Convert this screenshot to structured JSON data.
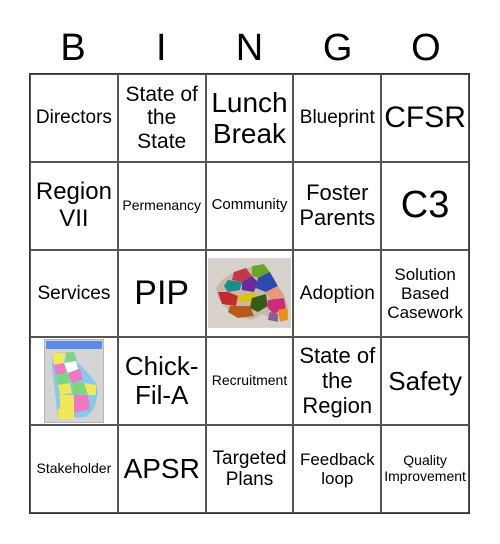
{
  "header": [
    "B",
    "I",
    "N",
    "G",
    "O"
  ],
  "cells": [
    {
      "text": "Directors",
      "size": "s19"
    },
    {
      "text": "State of the State",
      "size": "s21"
    },
    {
      "text": "Lunch Break",
      "size": "s28"
    },
    {
      "text": "Blueprint",
      "size": "s19"
    },
    {
      "text": "CFSR",
      "size": "s30"
    },
    {
      "text": "Region VII",
      "size": "s24"
    },
    {
      "text": "Permenancy",
      "size": "s14"
    },
    {
      "text": "Community",
      "size": "s15"
    },
    {
      "text": "Foster Parents",
      "size": "s22"
    },
    {
      "text": "C3",
      "size": "s38"
    },
    {
      "text": "Services",
      "size": "s19"
    },
    {
      "text": "PIP",
      "size": "s34"
    },
    {
      "image": "region-map-photo"
    },
    {
      "text": "Adoption",
      "size": "s19"
    },
    {
      "text": "Solution Based Casework",
      "size": "s17"
    },
    {
      "image": "georgia-regions-map"
    },
    {
      "text": "Chick-Fil-A",
      "size": "s26"
    },
    {
      "text": "Recruitment",
      "size": "s14"
    },
    {
      "text": "State of the Region",
      "size": "s22"
    },
    {
      "text": "Safety",
      "size": "s26"
    },
    {
      "text": "Stakeholder",
      "size": "s14"
    },
    {
      "text": "APSR",
      "size": "s28"
    },
    {
      "text": "Targeted Plans",
      "size": "s19"
    },
    {
      "text": "Feedback loop",
      "size": "s17"
    },
    {
      "text": "Quality Improvement",
      "size": "s14"
    }
  ]
}
